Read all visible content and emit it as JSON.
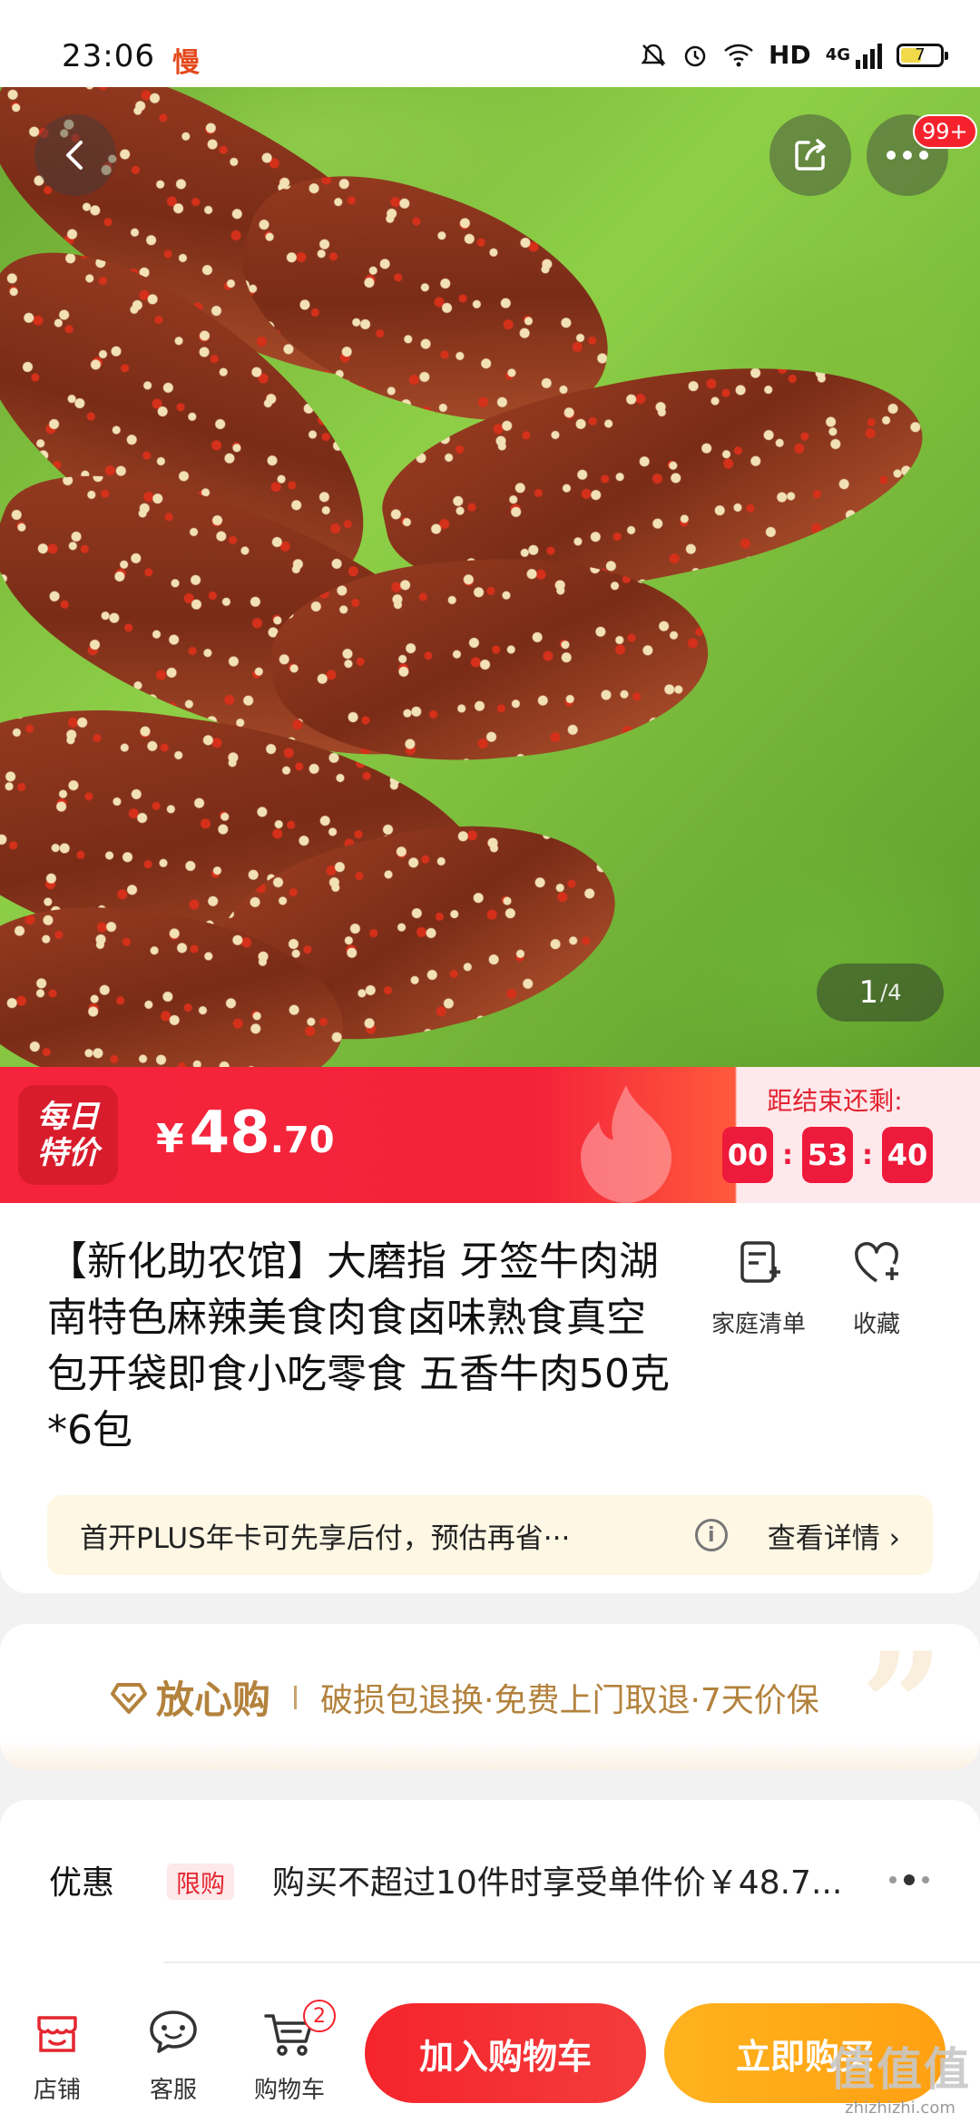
{
  "status_bar": {
    "time": "23:06",
    "app_badge": "慢",
    "network": "HD",
    "net_gen": "4G",
    "battery": "7"
  },
  "gallery": {
    "more_badge": "99+",
    "current": "1",
    "total": "/4"
  },
  "price_band": {
    "tag_line1": "每日",
    "tag_line2": "特价",
    "currency": "¥",
    "price_int": "48",
    "price_dec": ".70",
    "countdown_label": "距结束还剩:",
    "countdown": [
      "00",
      "53",
      "40"
    ]
  },
  "product": {
    "title": "【新化助农馆】大磨指 牙签牛肉湖南特色麻辣美食肉食卤味熟食真空包开袋即食小吃零食 五香牛肉50克*6包",
    "family_list_label": "家庭清单",
    "favorite_label": "收藏",
    "plus_msg": "首开PLUS年卡可先享后付，预估再省···",
    "plus_info": "i",
    "plus_detail": "查看详情 ›"
  },
  "assurance": {
    "title": "放心购",
    "text": "破损包退换·免费上门取退·7天价保",
    "quote": "”"
  },
  "promo": {
    "label": "优惠",
    "tag": "限购",
    "text": "购买不超过10件时享受单件价￥48.7..."
  },
  "bottom_bar": {
    "store": "店铺",
    "service": "客服",
    "cart": "购物车",
    "cart_count": "2",
    "add_to_cart": "加入购物车",
    "buy_now": "立即购买",
    "watermark": "值值值",
    "watermark_sub": "zhizhizhi.com"
  },
  "colors": {
    "accent_red": "#f5243c",
    "buy_orange": "#ffa012",
    "assure_gold": "#b3823c"
  }
}
